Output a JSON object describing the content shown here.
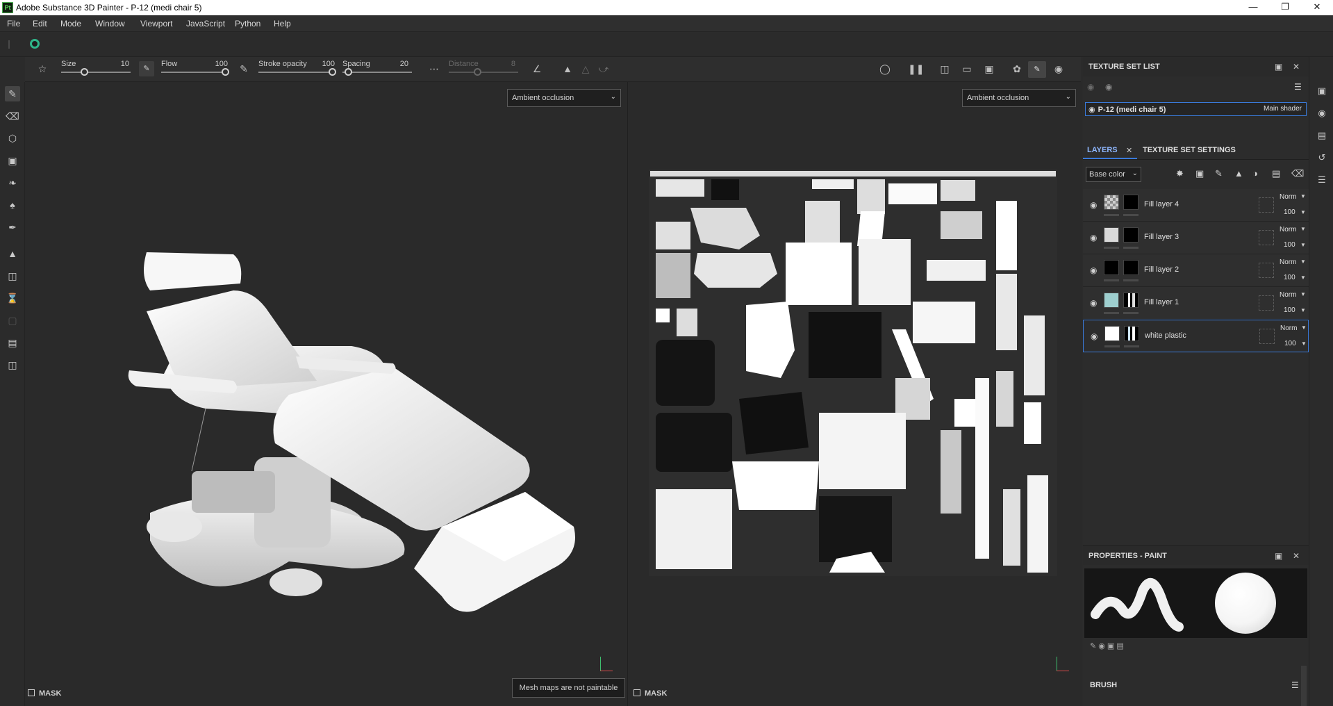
{
  "window": {
    "title": "Adobe Substance 3D Painter - P-12 (medi chair 5)",
    "app_icon": "Pt",
    "controls": [
      "minimize-icon",
      "restore-icon",
      "close-icon"
    ]
  },
  "menu": [
    "File",
    "Edit",
    "Mode",
    "Window",
    "Viewport",
    "JavaScript",
    "Python",
    "Help"
  ],
  "tool_options": {
    "size_label": "Size",
    "size_value": "10",
    "flow_label": "Flow",
    "flow_value": "100",
    "stroke_opacity_label": "Stroke opacity",
    "stroke_opacity_value": "100",
    "spacing_label": "Spacing",
    "spacing_value": "20",
    "distance_label": "Distance",
    "distance_value": "8"
  },
  "viewport3d": {
    "channel": "Ambient occlusion",
    "mask_label": "MASK"
  },
  "viewport2d": {
    "channel": "Ambient occlusion",
    "mask_label": "MASK"
  },
  "tooltip": "Mesh maps are not paintable",
  "texture_set_list": {
    "title": "TEXTURE SET LIST",
    "set_name": "P-12 (medi chair 5)",
    "shader": "Main shader"
  },
  "layers_panel": {
    "tab_layers": "LAYERS",
    "tab_settings": "TEXTURE SET SETTINGS",
    "channel": "Base color",
    "layers": [
      {
        "name": "Fill layer 4",
        "blend": "Norm",
        "opacity": "100",
        "color": "#9a9a9a"
      },
      {
        "name": "Fill layer 3",
        "blend": "Norm",
        "opacity": "100",
        "color": "#d9d9d9"
      },
      {
        "name": "Fill layer 2",
        "blend": "Norm",
        "opacity": "100",
        "color": "#000000"
      },
      {
        "name": "Fill layer 1",
        "blend": "Norm",
        "opacity": "100",
        "color": "#9ecfcf"
      },
      {
        "name": "white plastic",
        "blend": "Norm",
        "opacity": "100",
        "color": "#ffffff"
      }
    ]
  },
  "properties": {
    "title": "PROPERTIES - PAINT",
    "section": "BRUSH"
  },
  "colors": {
    "accent": "#3a7ad9",
    "panel": "#2c2c2c",
    "viewport": "#2a2a2a"
  }
}
